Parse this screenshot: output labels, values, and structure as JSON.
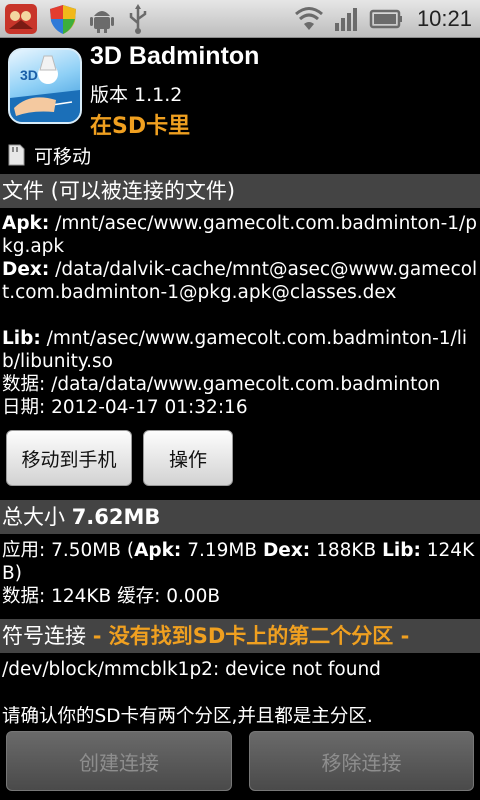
{
  "status_bar": {
    "time": "10:21",
    "left_icons": [
      "app-notification-icon",
      "shield-icon",
      "android-icon",
      "usb-icon"
    ],
    "right_icons": [
      "wifi-icon",
      "signal-icon",
      "battery-icon"
    ]
  },
  "app": {
    "name": "3D Badminton",
    "version": "版本 1.1.2",
    "location": "在SD卡里",
    "icon_label": "3D",
    "movable": "可移动"
  },
  "files_section": {
    "header": "文件 (可以被连接的文件)",
    "apk_label": "Apk:",
    "apk_value": " /mnt/asec/www.gamecolt.com.badminton-1/pkg.apk",
    "dex_label": "Dex:",
    "dex_value": " /data/dalvik-cache/mnt@asec@www.gamecolt.com.badminton-1@pkg.apk@classes.dex",
    "lib_label": "Lib:",
    "lib_value": " /mnt/asec/www.gamecolt.com.badminton-1/lib/libunity.so",
    "data_line": "数据: /data/data/www.gamecolt.com.badminton",
    "date_line": "日期: 2012-04-17 01:32:16"
  },
  "buttons": {
    "move_to_phone": "移动到手机",
    "operations": "操作"
  },
  "size_section": {
    "header_prefix": "总大小 ",
    "header_value": "7.62MB",
    "app_prefix": "应用: 7.50MB (",
    "apk_label": "Apk:",
    "apk_value": " 7.19MB ",
    "dex_label": "Dex:",
    "dex_value": " 188KB ",
    "lib_label": "Lib:",
    "lib_value": " 124KB)",
    "data_cache_line": "数据: 124KB 缓存: 0.00B"
  },
  "symlink_section": {
    "header_prefix": "符号连接 ",
    "header_warning": "- 没有找到SD卡上的第二个分区 -",
    "device_status": "/dev/block/mmcblk1p2: device not found",
    "hint": "请确认你的SD卡有两个分区,并且都是主分区."
  },
  "bottom_buttons": {
    "create_link": "创建连接",
    "remove_link": "移除连接"
  }
}
